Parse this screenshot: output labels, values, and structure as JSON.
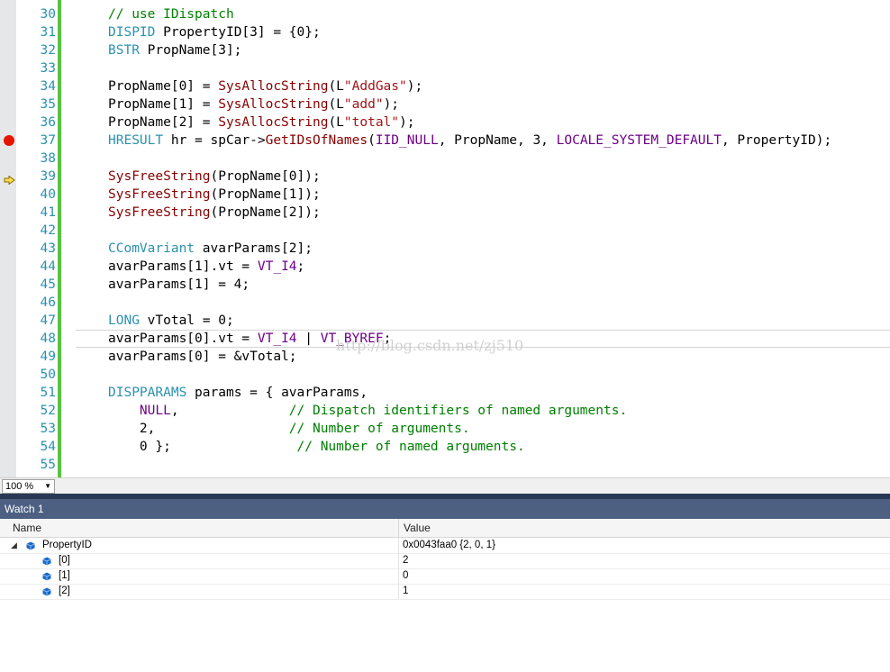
{
  "editor": {
    "lines": [
      {
        "num": "30",
        "tokens": [
          {
            "t": "// use IDispatch",
            "c": "cm"
          }
        ]
      },
      {
        "num": "31",
        "tokens": [
          {
            "t": "DISPID",
            "c": "ty"
          },
          {
            "t": " PropertyID[3] = {0};",
            "c": ""
          }
        ]
      },
      {
        "num": "32",
        "tokens": [
          {
            "t": "BSTR",
            "c": "ty"
          },
          {
            "t": " PropName[3];",
            "c": ""
          }
        ]
      },
      {
        "num": "33",
        "tokens": []
      },
      {
        "num": "34",
        "tokens": [
          {
            "t": "PropName[0] = ",
            "c": ""
          },
          {
            "t": "SysAllocString",
            "c": "fn"
          },
          {
            "t": "(L",
            "c": ""
          },
          {
            "t": "\"AddGas\"",
            "c": "st"
          },
          {
            "t": ");",
            "c": ""
          }
        ]
      },
      {
        "num": "35",
        "tokens": [
          {
            "t": "PropName[1] = ",
            "c": ""
          },
          {
            "t": "SysAllocString",
            "c": "fn"
          },
          {
            "t": "(L",
            "c": ""
          },
          {
            "t": "\"add\"",
            "c": "st"
          },
          {
            "t": ");",
            "c": ""
          }
        ]
      },
      {
        "num": "36",
        "tokens": [
          {
            "t": "PropName[2] = ",
            "c": ""
          },
          {
            "t": "SysAllocString",
            "c": "fn"
          },
          {
            "t": "(L",
            "c": ""
          },
          {
            "t": "\"total\"",
            "c": "st"
          },
          {
            "t": ");",
            "c": ""
          }
        ]
      },
      {
        "num": "37",
        "marker": "breakpoint",
        "tokens": [
          {
            "t": "HRESULT",
            "c": "ty"
          },
          {
            "t": " hr = spCar->",
            "c": ""
          },
          {
            "t": "GetIDsOfNames",
            "c": "fn"
          },
          {
            "t": "(",
            "c": ""
          },
          {
            "t": "IID_NULL",
            "c": "mc"
          },
          {
            "t": ", PropName, 3, ",
            "c": ""
          },
          {
            "t": "LOCALE_SYSTEM_DEFAULT",
            "c": "mc"
          },
          {
            "t": ", PropertyID);",
            "c": ""
          }
        ]
      },
      {
        "num": "38",
        "tokens": []
      },
      {
        "num": "39",
        "marker": "current-statement",
        "tokens": [
          {
            "t": "SysFreeString",
            "c": "fn"
          },
          {
            "t": "(PropName[0]);",
            "c": ""
          }
        ]
      },
      {
        "num": "40",
        "tokens": [
          {
            "t": "SysFreeString",
            "c": "fn"
          },
          {
            "t": "(PropName[1]);",
            "c": ""
          }
        ]
      },
      {
        "num": "41",
        "tokens": [
          {
            "t": "SysFreeString",
            "c": "fn"
          },
          {
            "t": "(PropName[2]);",
            "c": ""
          }
        ]
      },
      {
        "num": "42",
        "tokens": []
      },
      {
        "num": "43",
        "tokens": [
          {
            "t": "CComVariant",
            "c": "ty"
          },
          {
            "t": " avarParams[2];",
            "c": ""
          }
        ]
      },
      {
        "num": "44",
        "tokens": [
          {
            "t": "avarParams[1].vt = ",
            "c": ""
          },
          {
            "t": "VT_I4",
            "c": "mc"
          },
          {
            "t": ";",
            "c": ""
          }
        ]
      },
      {
        "num": "45",
        "tokens": [
          {
            "t": "avarParams[1] = 4;",
            "c": ""
          }
        ]
      },
      {
        "num": "46",
        "tokens": []
      },
      {
        "num": "47",
        "tokens": [
          {
            "t": "LONG",
            "c": "ty"
          },
          {
            "t": " vTotal = 0;",
            "c": ""
          }
        ]
      },
      {
        "num": "48",
        "highlight": true,
        "tokens": [
          {
            "t": "avarParams[0].vt = ",
            "c": ""
          },
          {
            "t": "VT_I4",
            "c": "mc"
          },
          {
            "t": " | ",
            "c": ""
          },
          {
            "t": "VT_BYREF",
            "c": "mc"
          },
          {
            "t": ";",
            "c": ""
          }
        ]
      },
      {
        "num": "49",
        "tokens": [
          {
            "t": "avarParams[0] = &vTotal;",
            "c": ""
          }
        ]
      },
      {
        "num": "50",
        "tokens": []
      },
      {
        "num": "51",
        "tokens": [
          {
            "t": "DISPPARAMS",
            "c": "ty"
          },
          {
            "t": " params = { avarParams,",
            "c": ""
          }
        ]
      },
      {
        "num": "52",
        "tokens": [
          {
            "t": "    ",
            "c": ""
          },
          {
            "t": "NULL",
            "c": "mc"
          },
          {
            "t": ",              ",
            "c": ""
          },
          {
            "t": "// Dispatch identifiers of named arguments.",
            "c": "cm"
          }
        ]
      },
      {
        "num": "53",
        "tokens": [
          {
            "t": "    2,                 ",
            "c": ""
          },
          {
            "t": "// Number of arguments.",
            "c": "cm"
          }
        ]
      },
      {
        "num": "54",
        "tokens": [
          {
            "t": "    0 };                ",
            "c": ""
          },
          {
            "t": "// Number of named arguments.",
            "c": "cm"
          }
        ]
      },
      {
        "num": "55",
        "tokens": []
      }
    ],
    "watermark": "http://blog.csdn.net/zj510"
  },
  "zoom": {
    "value": "100 %"
  },
  "watch": {
    "title": "Watch 1",
    "columns": {
      "name": "Name",
      "value": "Value"
    },
    "rows": [
      {
        "name": "PropertyID",
        "value": "0x0043faa0 {2, 0, 1}",
        "level": 0,
        "expanded": true
      },
      {
        "name": "[0]",
        "value": "2",
        "level": 1
      },
      {
        "name": "[1]",
        "value": "0",
        "level": 1
      },
      {
        "name": "[2]",
        "value": "1",
        "level": 1
      }
    ]
  },
  "colors": {
    "breakpoint": "#e51400",
    "change_bar": "#58c341",
    "watch_title_bg": "#4d6082",
    "splitter": "#293955"
  },
  "icons": {
    "breakpoint": "breakpoint-icon",
    "current_statement": "current-statement-arrow-icon",
    "expand": "expanded-triangle-icon",
    "member": "member-cube-icon",
    "dropdown": "dropdown-arrow-icon"
  }
}
